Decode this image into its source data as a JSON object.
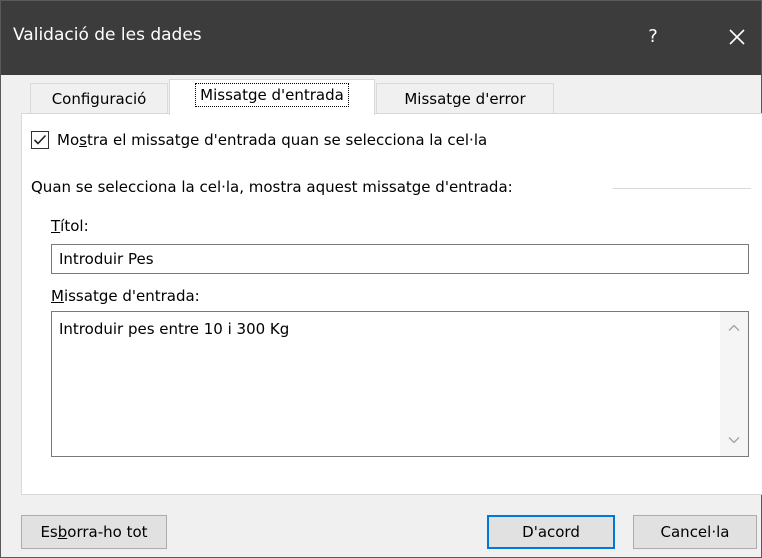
{
  "window": {
    "title": "Validació de les dades",
    "help": "?"
  },
  "tabs": [
    {
      "label": "Configuració"
    },
    {
      "label": "Missatge d'entrada"
    },
    {
      "label": "Missatge d'error"
    }
  ],
  "show_message": {
    "checked": true,
    "label_pre": "Mo",
    "label_key": "s",
    "label_post": "tra el missatge d'entrada quan se selecciona la cel·la"
  },
  "group_label": "Quan se selecciona la cel·la, mostra aquest missatge d'entrada:",
  "title_field": {
    "label_key": "T",
    "label_post": "ítol:",
    "value": "Introduir Pes"
  },
  "message_field": {
    "label_key": "M",
    "label_post": "issatge d'entrada:",
    "value": "Introduir pes entre 10 i 300 Kg"
  },
  "buttons": {
    "clear_pre": "Es",
    "clear_key": "b",
    "clear_post": "orra-ho tot",
    "ok": "D'acord",
    "cancel": "Cancel·la"
  }
}
